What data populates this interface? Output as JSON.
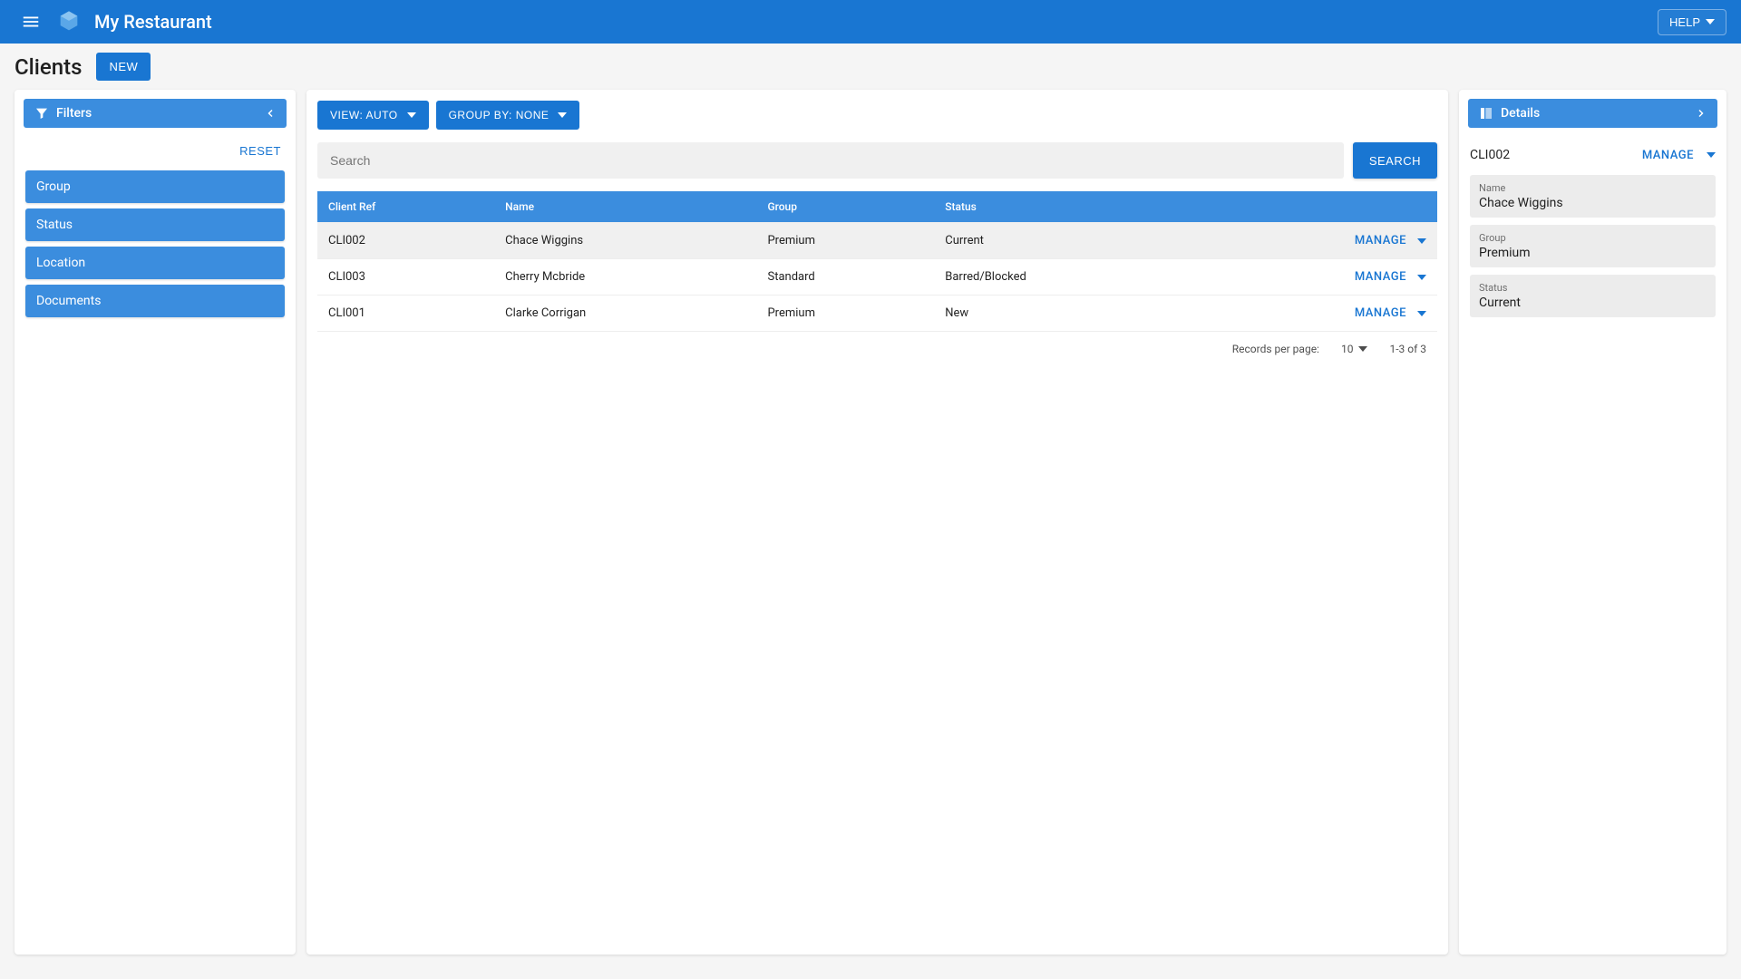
{
  "header": {
    "app_title": "My Restaurant",
    "help_label": "HELP"
  },
  "page": {
    "title": "Clients",
    "new_label": "NEW"
  },
  "filters": {
    "title": "Filters",
    "reset_label": "RESET",
    "items": [
      "Group",
      "Status",
      "Location",
      "Documents"
    ]
  },
  "toolbar": {
    "view_label": "VIEW: AUTO",
    "group_by_label": "GROUP BY: NONE"
  },
  "search": {
    "placeholder": "Search",
    "button_label": "SEARCH"
  },
  "table": {
    "columns": [
      "Client Ref",
      "Name",
      "Group",
      "Status"
    ],
    "manage_label": "MANAGE",
    "rows": [
      {
        "ref": "CLI002",
        "name": "Chace Wiggins",
        "group": "Premium",
        "status": "Current",
        "selected": true
      },
      {
        "ref": "CLI003",
        "name": "Cherry Mcbride",
        "group": "Standard",
        "status": "Barred/Blocked",
        "selected": false
      },
      {
        "ref": "CLI001",
        "name": "Clarke Corrigan",
        "group": "Premium",
        "status": "New",
        "selected": false
      }
    ],
    "footer": {
      "records_label": "Records per page:",
      "per_page": "10",
      "range": "1-3 of 3"
    }
  },
  "details": {
    "title": "Details",
    "ref": "CLI002",
    "manage_label": "MANAGE",
    "fields": [
      {
        "label": "Name",
        "value": "Chace Wiggins"
      },
      {
        "label": "Group",
        "value": "Premium"
      },
      {
        "label": "Status",
        "value": "Current"
      }
    ]
  }
}
